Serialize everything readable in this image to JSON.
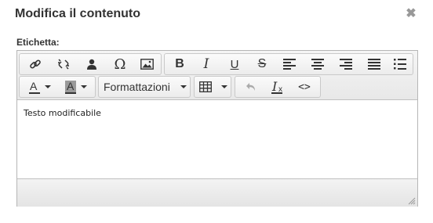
{
  "dialog": {
    "title": "Modifica il contenuto",
    "close_symbol": "✖"
  },
  "field": {
    "label": "Etichetta:"
  },
  "toolbar": {
    "row1": [
      {
        "icon": "link-icon"
      },
      {
        "icon": "unlink-icon"
      },
      {
        "icon": "anchor-user-icon"
      },
      {
        "icon": "special-char-icon",
        "text": "Ω"
      },
      {
        "icon": "image-icon"
      },
      {
        "icon": "bold-icon",
        "text": "B"
      },
      {
        "icon": "italic-icon",
        "text": "I"
      },
      {
        "icon": "underline-icon",
        "text": "U"
      },
      {
        "icon": "strikethrough-icon",
        "text": "S"
      },
      {
        "icon": "align-left-icon"
      },
      {
        "icon": "align-center-icon"
      },
      {
        "icon": "align-right-icon"
      },
      {
        "icon": "align-justify-icon"
      },
      {
        "icon": "bullet-list-icon"
      }
    ],
    "text_color_letter": "A",
    "bg_color_letter": "A",
    "formats_label": "Formattazioni",
    "undo_icon": "undo-icon",
    "clear_format_letter": "I",
    "clear_format_sub": "x",
    "code_symbol": "<>"
  },
  "content": {
    "text": "Testo modificabile"
  },
  "colors": {
    "title": "#333333",
    "border": "#b6b6b6",
    "toolbar_bg": "#f0f0f0",
    "icon": "#333333",
    "close": "#999999"
  }
}
